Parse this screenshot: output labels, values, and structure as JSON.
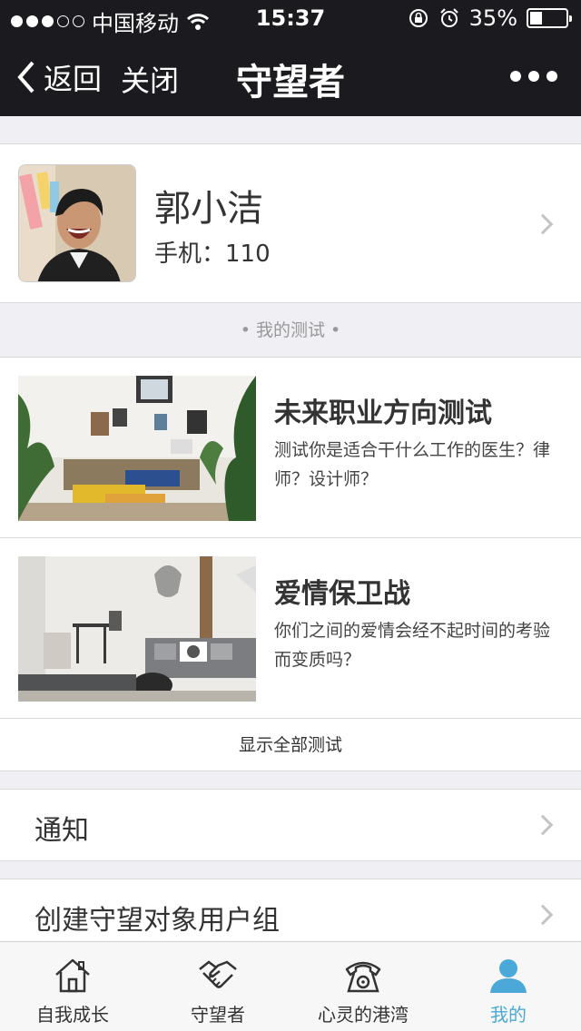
{
  "status_bar": {
    "carrier": "中国移动",
    "time": "15:37",
    "battery": "35%",
    "battery_level": 0.35,
    "signal_bars": 3
  },
  "nav": {
    "back_label": "返回",
    "close_label": "关闭",
    "title": "守望者",
    "more_icon": "more-dots-icon"
  },
  "profile": {
    "name": "郭小洁",
    "phone": "手机：110"
  },
  "tests_section": {
    "header": "• 我的测试 •",
    "items": [
      {
        "title": "未来职业方向测试",
        "description": "测试你是适合干什么工作的医生？律师？设计师？"
      },
      {
        "title": "爱情保卫战",
        "description": "你们之间的爱情会经不起时间的考验而变质吗？"
      }
    ],
    "show_all": "显示全部测试"
  },
  "menu": {
    "notify": "通知",
    "create_group": "创建守望对象用户组"
  },
  "tab_bar": {
    "items": [
      {
        "label": "自我成长",
        "icon": "house-icon"
      },
      {
        "label": "守望者",
        "icon": "handshake-icon"
      },
      {
        "label": "心灵的港湾",
        "icon": "telephone-icon"
      },
      {
        "label": "我的",
        "icon": "person-icon"
      }
    ],
    "active_index": 3
  },
  "colors": {
    "header_bg": "#1b1b1f",
    "accent": "#4aa9d8",
    "page_bg": "#efeff4"
  }
}
